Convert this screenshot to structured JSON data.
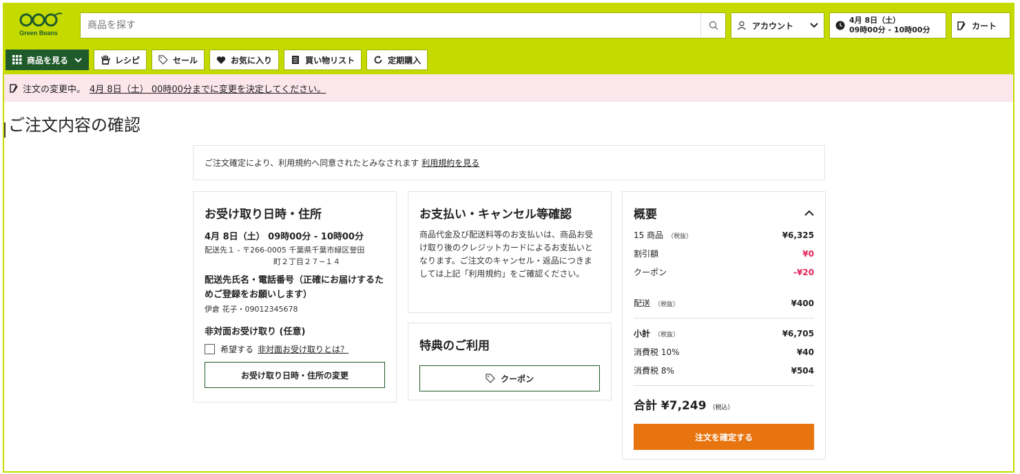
{
  "brand": {
    "name": "Green Beans",
    "color": "#c5db00",
    "dark": "#1f5a2b",
    "accent": "#e8740f"
  },
  "header": {
    "search_placeholder": "商品を探す",
    "account_label": "アカウント",
    "delivery_date": "4月 8日（土）",
    "delivery_time": "09時00分 - 10時00分",
    "cart_label": "カート"
  },
  "nav": {
    "items": [
      {
        "label": "商品を見る",
        "icon": "grid-icon"
      },
      {
        "label": "レシピ",
        "icon": "hand-icon"
      },
      {
        "label": "セール",
        "icon": "tag-icon"
      },
      {
        "label": "お気に入り",
        "icon": "heart-icon"
      },
      {
        "label": "買い物リスト",
        "icon": "list-icon"
      },
      {
        "label": "定期購入",
        "icon": "refresh-icon"
      }
    ]
  },
  "notice": {
    "text": "注文の変更中。",
    "link": "4月 8日（土） 00時00分までに変更を決定してください。"
  },
  "page": {
    "title": "ご注文内容の確認"
  },
  "terms": {
    "text": "ご注文確定により、利用規約へ同意されたとみなされます",
    "link": "利用規約を見る"
  },
  "delivery": {
    "title": "お受け取り日時・住所",
    "datetime": "4月 8日（土） 09時00分 - 10時00分",
    "address_line1": "配送先１ - 〒266-0005 千葉県千葉市緑区誉田",
    "address_line2": "町２丁目２７−１４",
    "contact_title": "配送先氏名・電話番号（正確にお届けするためご登録をお願いします）",
    "contact_value": "伊倉 花子・09012345678",
    "contactless_title": "非対面お受け取り (任意)",
    "contactless_check": "希望する",
    "contactless_link": "非対面お受け取りとは？",
    "change_button": "お受け取り日時・住所の変更"
  },
  "payment": {
    "title": "お支払い・キャンセル等確認",
    "text": "商品代金及び配送料等のお支払いは、商品お受け取り後のクレジットカードによるお支払いとなります。ご注文のキャンセル・返品につきましては上記「利用規約」をご確認ください。"
  },
  "benefits": {
    "title": "特典のご利用",
    "coupon_button": "クーポン"
  },
  "summary": {
    "title": "概要",
    "items_label": "15 商品",
    "tax_excl": "（税抜）",
    "items_value": "¥6,325",
    "discount_label": "割引額",
    "discount_value": "¥0",
    "coupon_label": "クーポン",
    "coupon_value": "-¥20",
    "shipping_label": "配送",
    "shipping_value": "¥400",
    "subtotal_label": "小計",
    "subtotal_value": "¥6,705",
    "tax10_label": "消費税 10%",
    "tax10_value": "¥40",
    "tax8_label": "消費税 8%",
    "tax8_value": "¥504",
    "total_label": "合計 ¥7,249",
    "tax_incl": "（税込）",
    "confirm_button": "注文を確定する"
  }
}
